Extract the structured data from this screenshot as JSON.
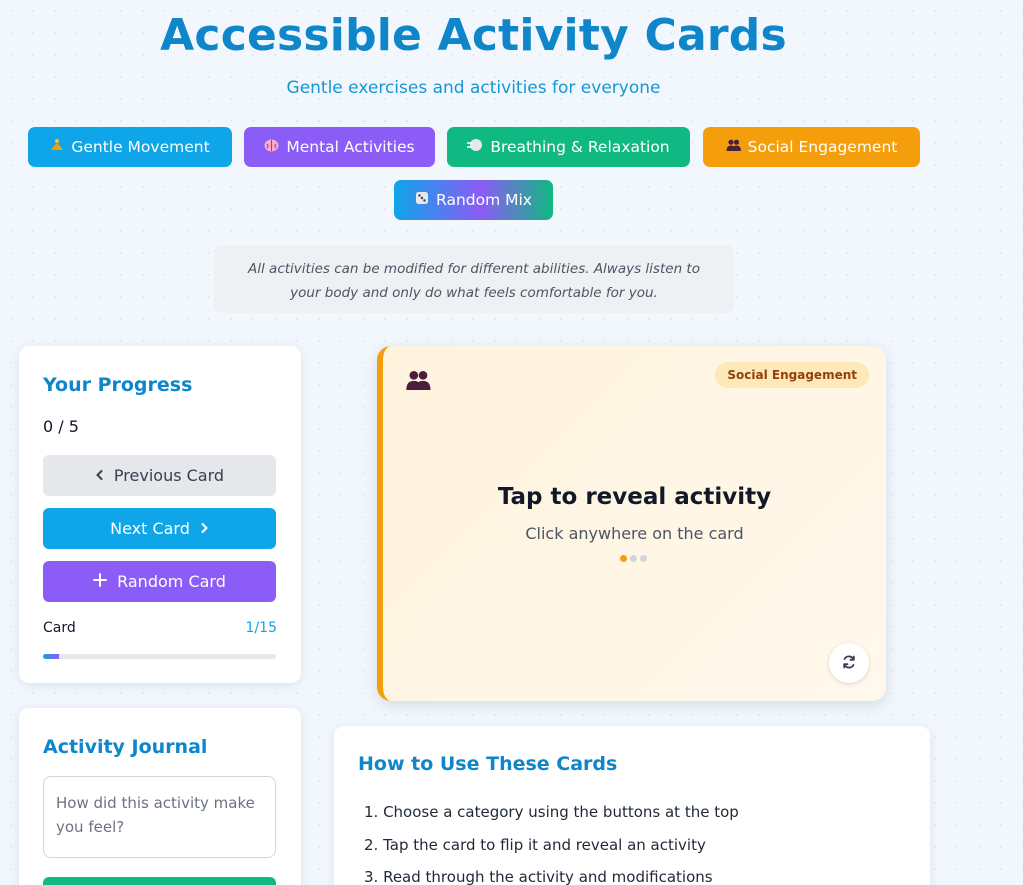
{
  "header": {
    "title": "Accessible Activity Cards",
    "subtitle": "Gentle exercises and activities for everyone"
  },
  "categories": [
    {
      "label": "Gentle Movement",
      "icon": "person-meditating-icon",
      "color": "#0ea5e9"
    },
    {
      "label": "Mental Activities",
      "icon": "brain-icon",
      "color": "#8b5cf6"
    },
    {
      "label": "Breathing & Relaxation",
      "icon": "wind-face-icon",
      "color": "#10b981"
    },
    {
      "label": "Social Engagement",
      "icon": "people-icon",
      "color": "#f59e0b"
    },
    {
      "label": "Random Mix",
      "icon": "dice-icon",
      "color": "#0ea5e9"
    }
  ],
  "note": "All activities can be modified for different abilities. Always listen to your body and only do what feels comfortable for you.",
  "progress": {
    "title": "Your Progress",
    "count": "0 / 5",
    "prev_label": "Previous Card",
    "next_label": "Next Card",
    "random_label": "Random Card",
    "card_label": "Card",
    "card_position": "1/15",
    "bar_fraction": 0.067
  },
  "journal": {
    "title": "Activity Journal",
    "placeholder": "How did this activity make you feel?"
  },
  "card": {
    "icon": "people-icon",
    "badge": "Social Engagement",
    "heading": "Tap to reveal activity",
    "hint": "Click anywhere on the card",
    "dots_total": 3,
    "dots_active": 0,
    "accent": "#f59e0b"
  },
  "howto": {
    "title": "How to Use These Cards",
    "steps": [
      "1. Choose a category using the buttons at the top",
      "2. Tap the card to flip it and reveal an activity",
      "3. Read through the activity and modifications"
    ]
  }
}
